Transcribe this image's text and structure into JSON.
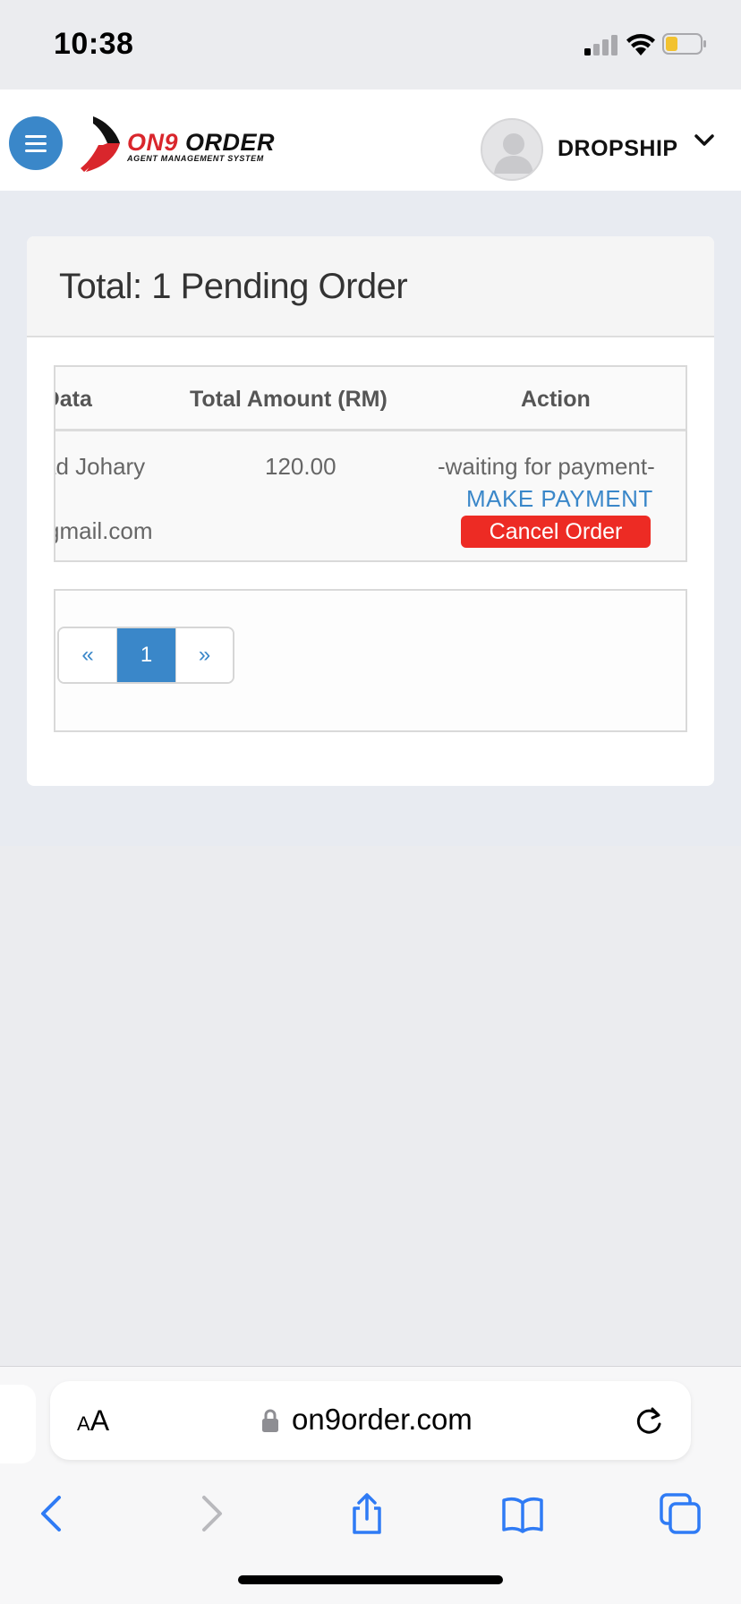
{
  "status_bar": {
    "time": "10:38"
  },
  "header": {
    "logo_brand_red": "ON9",
    "logo_brand_black": " ORDER",
    "logo_tagline": "AGENT MANAGEMENT SYSTEM",
    "user_name": "DROPSHIP"
  },
  "card": {
    "title": "Total: 1 Pending Order",
    "table": {
      "headers": [
        "r Data",
        "Total Amount (RM)",
        "Action"
      ],
      "rows": [
        {
          "name": "ad Johary",
          "email": "gmail.com",
          "amount": "120.00",
          "status": "-waiting for payment-",
          "pay_label": "MAKE PAYMENT",
          "cancel_label": "Cancel Order"
        }
      ]
    },
    "pagination": {
      "prev": "«",
      "current": "1",
      "next": "»"
    }
  },
  "browser": {
    "text_size_label": "AA",
    "url": "on9order.com"
  },
  "colors": {
    "accent": "#3a87c9",
    "danger": "#ed2b24",
    "logo_red": "#d9262c"
  }
}
